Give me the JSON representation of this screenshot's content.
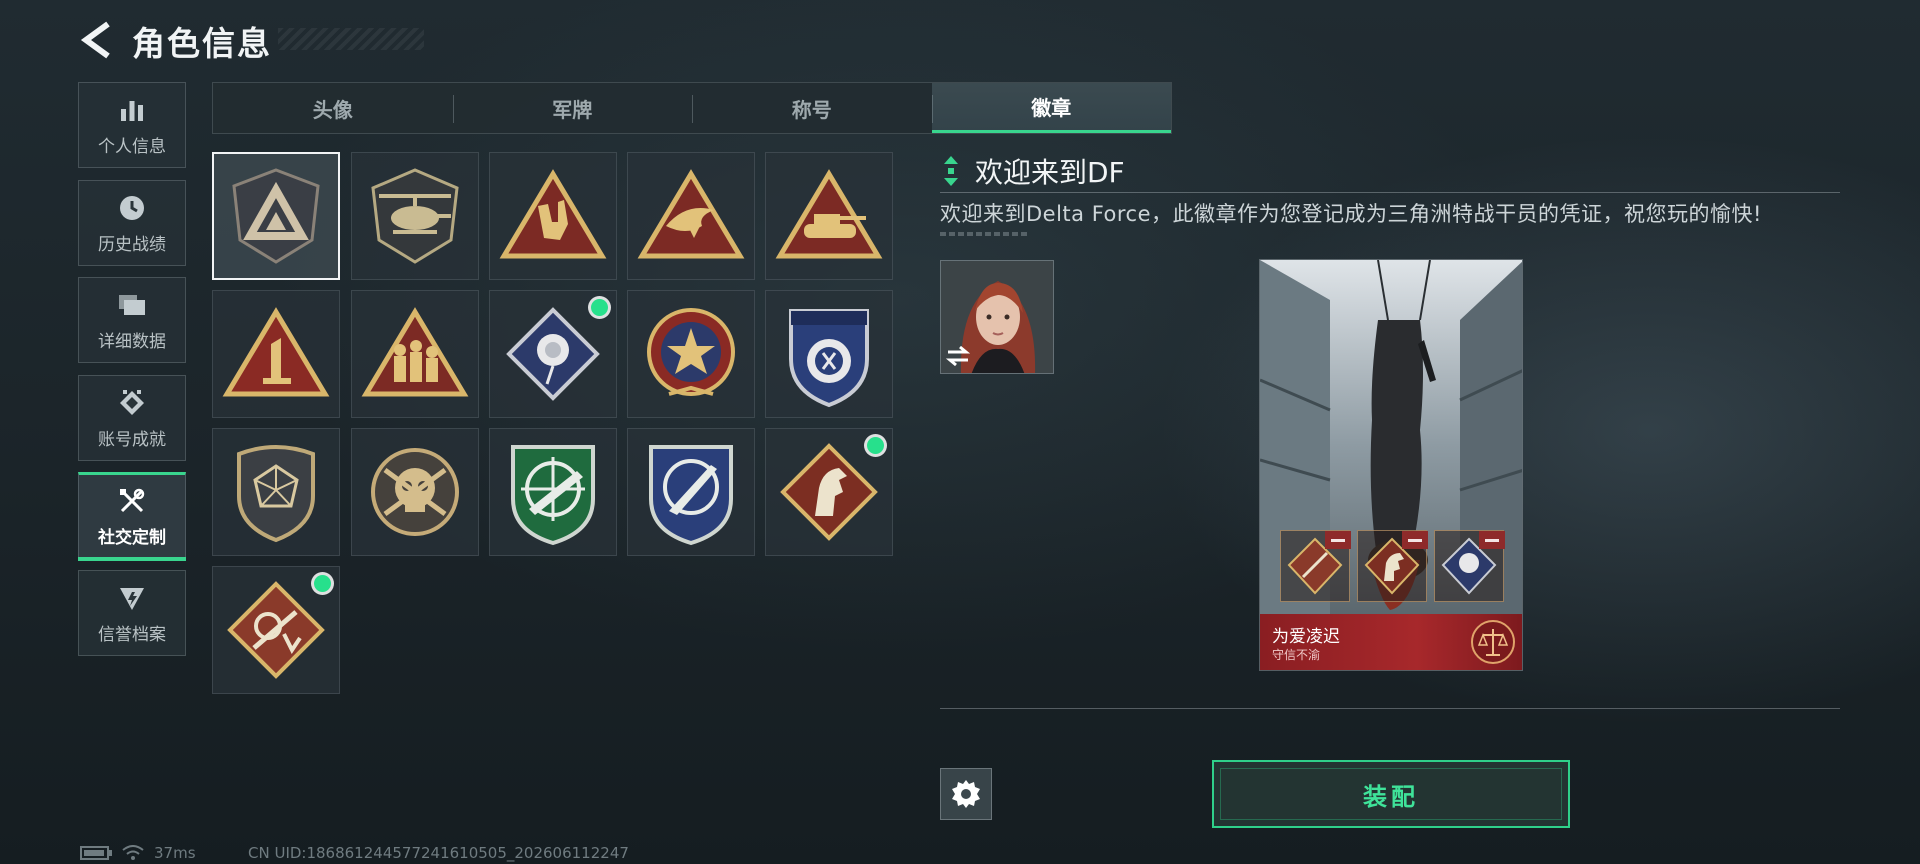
{
  "header": {
    "title": "角色信息"
  },
  "sidebar": {
    "items": [
      {
        "label": "个人信息",
        "icon": "bar-chart-icon"
      },
      {
        "label": "历史战绩",
        "icon": "clock-icon"
      },
      {
        "label": "详细数据",
        "icon": "folder-icon"
      },
      {
        "label": "账号成就",
        "icon": "achievement-icon"
      },
      {
        "label": "社交定制",
        "icon": "tools-icon",
        "active": true
      },
      {
        "label": "信誉档案",
        "icon": "credit-icon"
      }
    ]
  },
  "tabs": [
    {
      "label": "头像"
    },
    {
      "label": "军牌"
    },
    {
      "label": "称号"
    },
    {
      "label": "徽章",
      "active": true
    }
  ],
  "badges": [
    {
      "icon": "delta-triangle-badge-icon",
      "selected": true
    },
    {
      "icon": "helicopter-badge-icon"
    },
    {
      "icon": "rock-hand-badge-icon"
    },
    {
      "icon": "bird-badge-icon"
    },
    {
      "icon": "tank-badge-icon"
    },
    {
      "icon": "number-one-badge-icon"
    },
    {
      "icon": "soldiers-badge-icon"
    },
    {
      "icon": "rose-badge-icon",
      "new": true
    },
    {
      "icon": "star-shield-badge-icon"
    },
    {
      "icon": "blue-wing-badge-icon"
    },
    {
      "icon": "d20-shield-badge-icon"
    },
    {
      "icon": "skull-target-badge-icon"
    },
    {
      "icon": "green-rifle-badge-icon"
    },
    {
      "icon": "blue-knife-badge-icon"
    },
    {
      "icon": "horse-badge-icon",
      "new": true
    },
    {
      "icon": "rifle-music-badge-icon",
      "new": true
    }
  ],
  "detail": {
    "title": "欢迎来到DF",
    "description": "欢迎来到Delta Force，此徽章作为您登记成为三角洲特战干员的凭证，祝您玩的愉快!"
  },
  "character_card": {
    "name": "为爱凌迟",
    "subtitle": "守信不渝"
  },
  "actions": {
    "equip_label": "装配"
  },
  "status_bar": {
    "ping": "37ms",
    "uid": "CN UID:186861244577241610505_202606112247"
  },
  "colors": {
    "accent": "#39d58e",
    "new_dot": "#27e08c",
    "banner": "#a7282b"
  }
}
